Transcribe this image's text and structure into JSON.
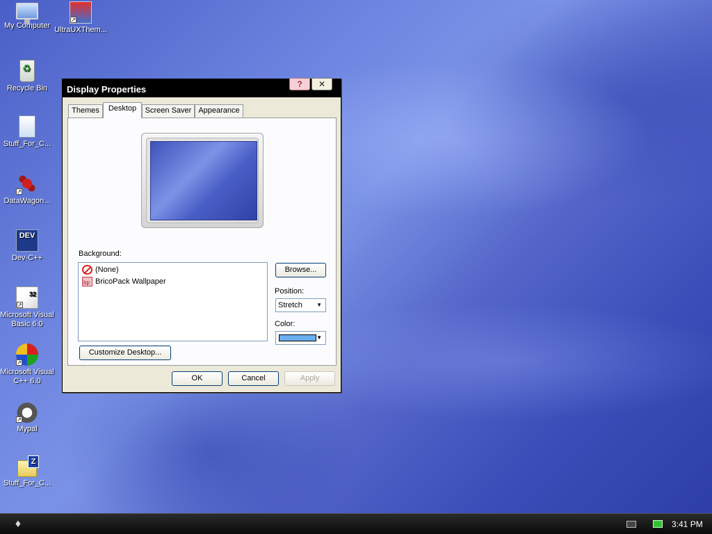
{
  "desktop": {
    "icons": [
      {
        "label": "My Computer"
      },
      {
        "label": "UltraUXThem..."
      },
      {
        "label": "Recycle Bin"
      },
      {
        "label": "Stuff_For_C..."
      },
      {
        "label": "DataWagon..."
      },
      {
        "label": "Dev-C++",
        "badge": "DEV"
      },
      {
        "label": "Microsoft Visual Basic 6.0"
      },
      {
        "label": "Microsoft Visual C++ 6.0"
      },
      {
        "label": "Mypal"
      },
      {
        "label": "Stuff_For_C..."
      }
    ]
  },
  "dialog": {
    "title": "Display Properties",
    "help_glyph": "?",
    "close_glyph": "✕",
    "tabs": [
      {
        "label": "Themes",
        "active": false
      },
      {
        "label": "Desktop",
        "active": true
      },
      {
        "label": "Screen Saver",
        "active": false
      },
      {
        "label": "Appearance",
        "active": false
      }
    ],
    "background_label": "Background:",
    "background_items": [
      {
        "label": "(None)",
        "icon": "no-wallpaper-icon"
      },
      {
        "label": "BricoPack Wallpaper",
        "icon": "wallpaper-file-icon"
      }
    ],
    "browse_label": "Browse...",
    "position_label": "Position:",
    "position_value": "Stretch",
    "color_label": "Color:",
    "color_value": "#6aaef0",
    "customize_label": "Customize Desktop...",
    "ok_label": "OK",
    "cancel_label": "Cancel",
    "apply_label": "Apply"
  },
  "taskbar": {
    "clock": "3:41 PM"
  },
  "colors": {
    "titlebar": "#000000",
    "dialog_bg": "#ece9d8",
    "taskbar": "#111111"
  }
}
